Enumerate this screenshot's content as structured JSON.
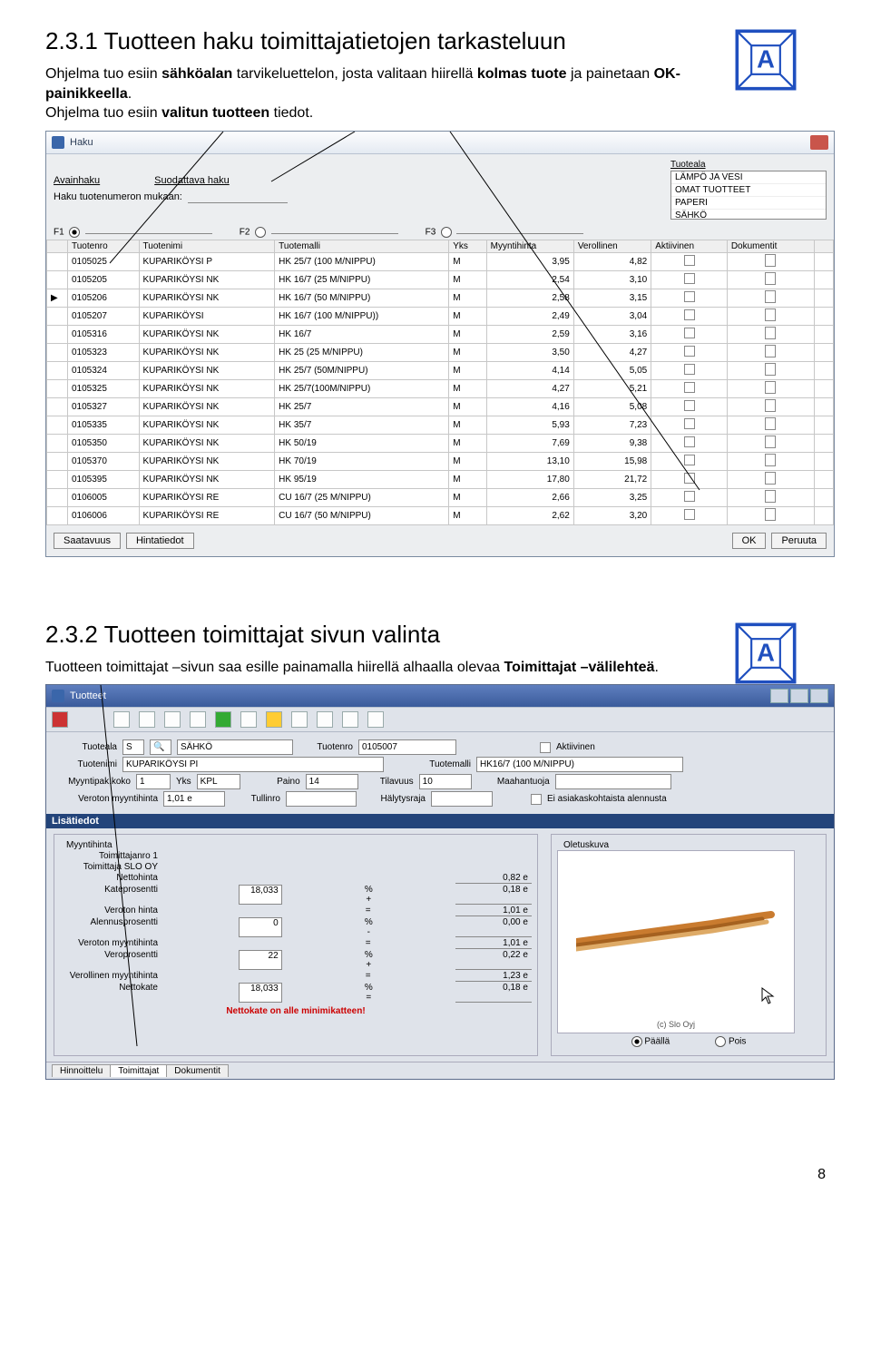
{
  "section231": {
    "heading": "2.3.1 Tuotteen haku toimittajatietojen tarkasteluun",
    "intro_html": "Ohjelma tuo esiin <b>sähköalan</b> tarvikeluettelon, josta valitaan hiirellä <b>kolmas tuote</b> ja painetaan <b>OK-painikkeella</b>.<br>Ohjelma tuo esiin <b>valitun tuotteen</b> tiedot."
  },
  "haku": {
    "title": "Haku",
    "avainhaku": "Avainhaku",
    "suodattava": "Suodattava haku",
    "haku_label": "Haku tuotenumeron mukaan:",
    "tuoteala": "Tuoteala",
    "tuoteala_items": [
      "LÄMPÖ JA VESI",
      "OMAT TUOTTEET",
      "PAPERI",
      "SÄHKÖ"
    ],
    "fcols": [
      "F1",
      "F2",
      "F3"
    ],
    "headers": [
      "Tuotenro",
      "Tuotenimi",
      "Tuotemalli",
      "Yks",
      "Myyntihinta",
      "Verollinen",
      "Aktiivinen",
      "Dokumentit"
    ],
    "rows": [
      [
        "0105025",
        "KUPARIKÖYSI P",
        "HK 25/7 (100 M/NIPPU)",
        "M",
        "3,95",
        "4,82"
      ],
      [
        "0105205",
        "KUPARIKÖYSI NK",
        "HK 16/7 (25 M/NIPPU)",
        "M",
        "2,54",
        "3,10"
      ],
      [
        "0105206",
        "KUPARIKÖYSI NK",
        "HK 16/7 (50 M/NIPPU)",
        "M",
        "2,58",
        "3,15"
      ],
      [
        "0105207",
        "KUPARIKÖYSI",
        "HK 16/7 (100 M/NIPPU))",
        "M",
        "2,49",
        "3,04"
      ],
      [
        "0105316",
        "KUPARIKÖYSI NK",
        "HK 16/7",
        "M",
        "2,59",
        "3,16"
      ],
      [
        "0105323",
        "KUPARIKÖYSI NK",
        "HK 25 (25 M/NIPPU)",
        "M",
        "3,50",
        "4,27"
      ],
      [
        "0105324",
        "KUPARIKÖYSI NK",
        "HK 25/7 (50M/NIPPU)",
        "M",
        "4,14",
        "5,05"
      ],
      [
        "0105325",
        "KUPARIKÖYSI NK",
        "HK 25/7(100M/NIPPU)",
        "M",
        "4,27",
        "5,21"
      ],
      [
        "0105327",
        "KUPARIKÖYSI NK",
        "HK 25/7",
        "M",
        "4,16",
        "5,08"
      ],
      [
        "0105335",
        "KUPARIKÖYSI NK",
        "HK 35/7",
        "M",
        "5,93",
        "7,23"
      ],
      [
        "0105350",
        "KUPARIKÖYSI NK",
        "HK 50/19",
        "M",
        "7,69",
        "9,38"
      ],
      [
        "0105370",
        "KUPARIKÖYSI NK",
        "HK 70/19",
        "M",
        "13,10",
        "15,98"
      ],
      [
        "0105395",
        "KUPARIKÖYSI NK",
        "HK 95/19",
        "M",
        "17,80",
        "21,72"
      ],
      [
        "0106005",
        "KUPARIKÖYSI RE",
        "CU 16/7 (25 M/NIPPU)",
        "M",
        "2,66",
        "3,25"
      ],
      [
        "0106006",
        "KUPARIKÖYSI RE",
        "CU 16/7 (50 M/NIPPU)",
        "M",
        "2,62",
        "3,20"
      ]
    ],
    "saatavuus": "Saatavuus",
    "hintatiedot": "Hintatiedot",
    "ok": "OK",
    "peruuta": "Peruuta"
  },
  "section232": {
    "heading": "2.3.2 Tuotteen toimittajat sivun valinta",
    "intro_html": "Tuotteen toimittajat –sivun saa esille painamalla hiirellä alhaalla olevaa <b>Toimittajat –välilehteä</b>."
  },
  "tuotteet": {
    "title": "Tuotteet",
    "lisatiedot": "Lisätiedot",
    "fields": {
      "tuoteala_l": "Tuoteala",
      "tuoteala_s": "S",
      "tuoteala_n": "SÄHKÖ",
      "tuotenro_l": "Tuotenro",
      "tuotenro": "0105007",
      "aktiivinen": "Aktiivinen",
      "tuotenimi_l": "Tuotenimi",
      "tuotenimi": "KUPARIKÖYSI PI",
      "tuotemalli_l": "Tuotemalli",
      "tuotemalli": "HK16/7 (100 M/NIPPU)",
      "myyntipak_l": "Myyntipak.koko",
      "myyntipak": "1",
      "yks_l": "Yks",
      "yks": "KPL",
      "paino_l": "Paino",
      "paino": "14",
      "tilavuus_l": "Tilavuus",
      "tilavuus": "10",
      "maahantuoja_l": "Maahantuoja",
      "veroton_l": "Veroton myyntihinta",
      "veroton": "1,01 e",
      "tullinro_l": "Tullinro",
      "halytys_l": "Hälytysraja",
      "eiasiak": "Ei asiakaskohtaista alennusta"
    },
    "myyntihinta_title": "Myyntihinta",
    "supplier_l": "Toimittajanro 1",
    "supplier": "Toimittaja SLO OY",
    "lines": [
      [
        "Nettohinta",
        "",
        "",
        "0,82 e"
      ],
      [
        "Kateprosentti",
        "18,033",
        "% +",
        "0,18 e"
      ],
      [
        "Veroton hinta",
        "",
        "=",
        "1,01 e"
      ],
      [
        "Alennusprosentti",
        "0",
        "% -",
        "0,00 e"
      ],
      [
        "Veroton myyntihinta",
        "",
        "=",
        "1,01 e"
      ],
      [
        "Veroprosentti",
        "22",
        "% +",
        "0,22 e"
      ],
      [
        "Verollinen myyntihinta",
        "",
        "=",
        "1,23 e"
      ],
      [
        "Nettokate",
        "18,033",
        "% =",
        "0,18 e"
      ]
    ],
    "warn": "Nettokate on alle minimikatteen!",
    "oletuskuva": "Oletuskuva",
    "imgcap": "(c) Slo Oyj",
    "paalla": "Päällä",
    "pois": "Pois",
    "tabs": [
      "Hinnoittelu",
      "Toimittajat",
      "Dokumentit"
    ]
  },
  "page_number": "8"
}
